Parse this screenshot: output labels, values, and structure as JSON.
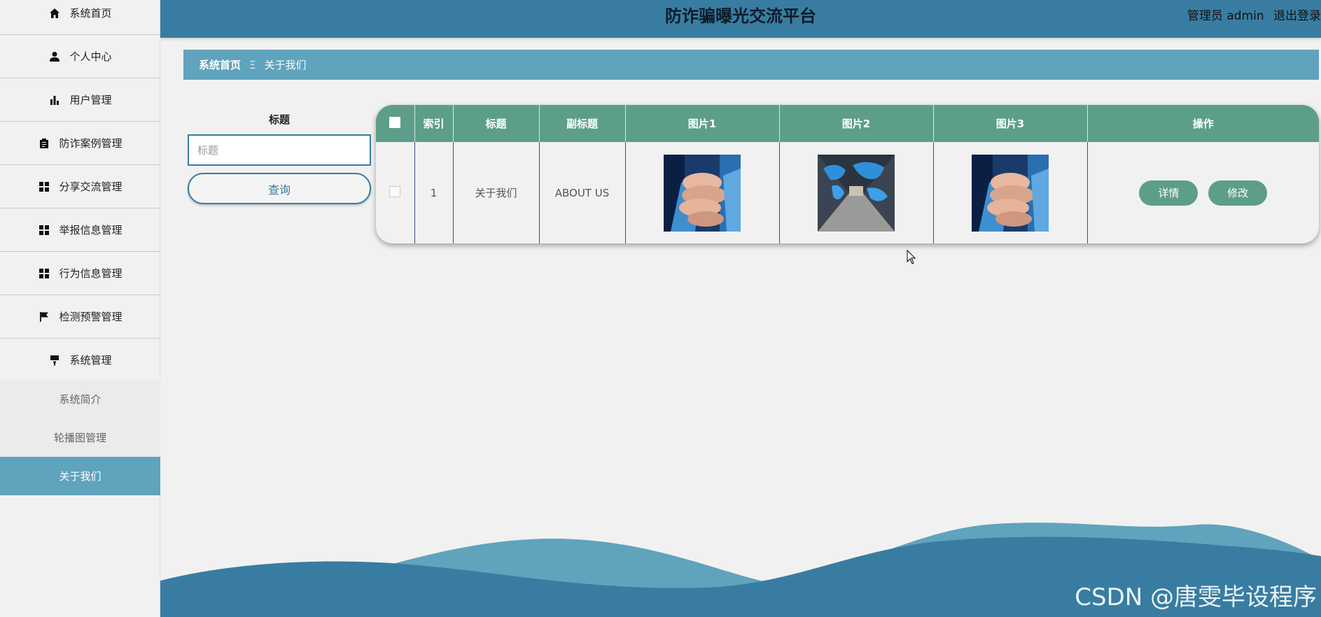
{
  "header": {
    "title": "防诈骗曝光交流平台",
    "user_label": "管理员 admin",
    "logout_label": "退出登录"
  },
  "sidebar": {
    "items": [
      {
        "label": "系统首页",
        "icon": "home-icon"
      },
      {
        "label": "个人中心",
        "icon": "user-icon"
      },
      {
        "label": "用户管理",
        "icon": "bar-chart-icon"
      },
      {
        "label": "防诈案例管理",
        "icon": "clipboard-icon"
      },
      {
        "label": "分享交流管理",
        "icon": "grid-icon"
      },
      {
        "label": "举报信息管理",
        "icon": "grid-icon"
      },
      {
        "label": "行为信息管理",
        "icon": "grid-icon"
      },
      {
        "label": "检测预警管理",
        "icon": "flag-icon"
      },
      {
        "label": "系统管理",
        "icon": "brush-icon"
      }
    ],
    "sub_items": [
      {
        "label": "系统简介",
        "active": false
      },
      {
        "label": "轮播图管理",
        "active": false
      },
      {
        "label": "关于我们",
        "active": true
      }
    ]
  },
  "breadcrumb": {
    "home": "系统首页",
    "separator": "Ξ",
    "current": "关于我们"
  },
  "search": {
    "label": "标题",
    "placeholder": "标题",
    "value": "",
    "button_label": "查询"
  },
  "table": {
    "columns": [
      "索引",
      "标题",
      "副标题",
      "图片1",
      "图片2",
      "图片3",
      "操作"
    ],
    "rows": [
      {
        "index": "1",
        "title": "关于我们",
        "subtitle": "ABOUT US",
        "images": [
          "handshake-team-photo",
          "world-map-corridor-photo",
          "handshake-team-photo"
        ],
        "actions": [
          "详情",
          "修改"
        ]
      }
    ]
  },
  "watermark": "CSDN @唐雯毕设程序",
  "colors": {
    "topbar": "#387da1",
    "accent_light": "#5fa3bd",
    "table_header": "#5c9e8a",
    "wave_dark": "#387da1",
    "wave_light": "#5fa3bd"
  }
}
